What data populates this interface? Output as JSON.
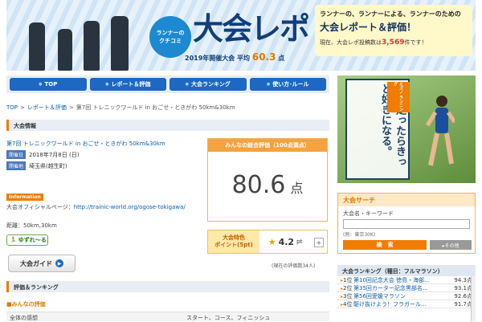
{
  "banner": {
    "kuchikomi_line1": "ランナーの",
    "kuchikomi_line2": "クチコミ",
    "logo": "大会レポ",
    "subtitle_prefix": "2019年開催大会 平均",
    "average_score": "60.3",
    "subtitle_suffix": "点",
    "tagline": "ランナーの、ランナーによる、ランナーのための",
    "headline": "大会レポート＆評価！",
    "posted_prefix": "現在、大会レポ投稿数は",
    "posted_count": "3,569",
    "posted_suffix": "件です！"
  },
  "nav": [
    "TOP",
    "レポート＆評価",
    "大会ランキング",
    "使い方･ルール"
  ],
  "breadcrumb": [
    "TOP",
    "レポート＆評価",
    "第7回 トレニックワールド in おごせ・ときがわ 50km&30km"
  ],
  "sections": {
    "info": "大会情報",
    "rating": "評価＆ランキング",
    "everyone": "■みんなの評価"
  },
  "event": {
    "name": "第7回 トレニックワールド in おごせ・ときがわ 50km&30km",
    "date_tag": "開催日",
    "date": "2018年7月8日 (日)",
    "place_tag": "開催地",
    "place": "埼玉県(越生町)",
    "info_tag": "Information",
    "official_label": "大会オフィシャルページ：",
    "official_url": "http://trainic-world.org/ogose-tokigawa/",
    "distance": "距離：50km,30km",
    "yuru_label": "ゆずれ〜る",
    "guide_button": "大会ガイド"
  },
  "score": {
    "header": "みんなの総合評価（100点満点）",
    "value": "80.6",
    "unit": "点"
  },
  "feature": {
    "label_line1": "大会特色",
    "label_line2": "ポイント(5pt)",
    "value": "4.2",
    "unit": "pt",
    "plus": "+"
  },
  "count_text": "(現在の評価数34人)",
  "table": {
    "col1": "全体の感想",
    "col2": "スタート、コース、フィニッシュ"
  },
  "ad": {
    "text": "一度走ったらきっと好きになる。",
    "corner": "ミズノ ランニング"
  },
  "search": {
    "title": "大会サーチ",
    "label": "大会名・キーワード",
    "placeholder": "",
    "example": "(例：東京30K)",
    "button": "検　索",
    "option": "▸その他"
  },
  "ranking": {
    "title": "大会ランキング（種目：フルマラソン）",
    "rows": [
      {
        "rank": "1位",
        "name": "第10回記念大会 徳島・海部…",
        "score": "94.3点"
      },
      {
        "rank": "2位",
        "name": "第35回カーター記念黒部名…",
        "score": "93.1点"
      },
      {
        "rank": "3位",
        "name": "第56回愛媛マラソン",
        "score": "92.6点"
      },
      {
        "rank": "4位",
        "name": "駆け抜けよう！フラガール…",
        "score": "91.7点"
      }
    ]
  }
}
